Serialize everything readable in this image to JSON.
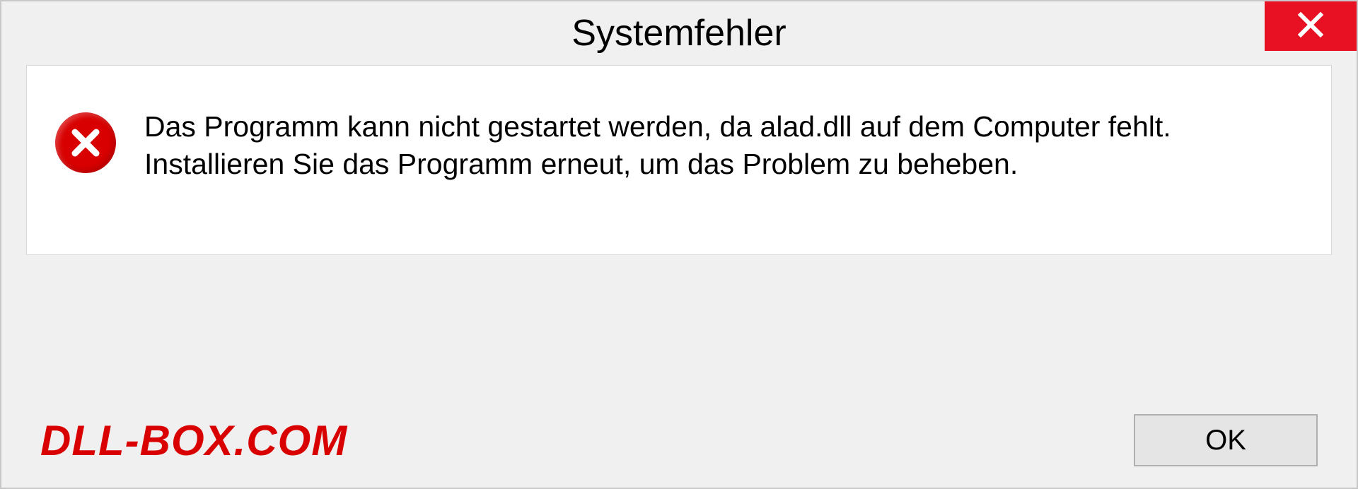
{
  "dialog": {
    "title": "Systemfehler",
    "message": "Das Programm kann nicht gestartet werden, da alad.dll auf dem Computer fehlt. Installieren Sie das Programm erneut, um das Problem zu beheben.",
    "ok_label": "OK"
  },
  "watermark": "DLL-BOX.COM"
}
